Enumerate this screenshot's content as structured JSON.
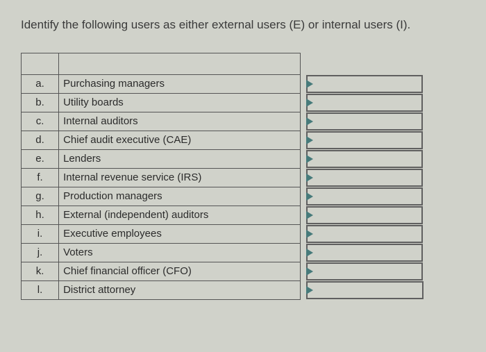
{
  "prompt": "Identify the following users as either external users (E) or internal users (I).",
  "rows": [
    {
      "letter": "a.",
      "desc": "Purchasing managers"
    },
    {
      "letter": "b.",
      "desc": "Utility boards"
    },
    {
      "letter": "c.",
      "desc": "Internal auditors"
    },
    {
      "letter": "d.",
      "desc": "Chief audit executive (CAE)"
    },
    {
      "letter": "e.",
      "desc": "Lenders"
    },
    {
      "letter": "f.",
      "desc": "Internal revenue service (IRS)"
    },
    {
      "letter": "g.",
      "desc": "Production managers"
    },
    {
      "letter": "h.",
      "desc": "External (independent) auditors"
    },
    {
      "letter": "i.",
      "desc": "Executive employees"
    },
    {
      "letter": "j.",
      "desc": "Voters"
    },
    {
      "letter": "k.",
      "desc": "Chief financial officer (CFO)"
    },
    {
      "letter": "l.",
      "desc": "District attorney"
    }
  ]
}
